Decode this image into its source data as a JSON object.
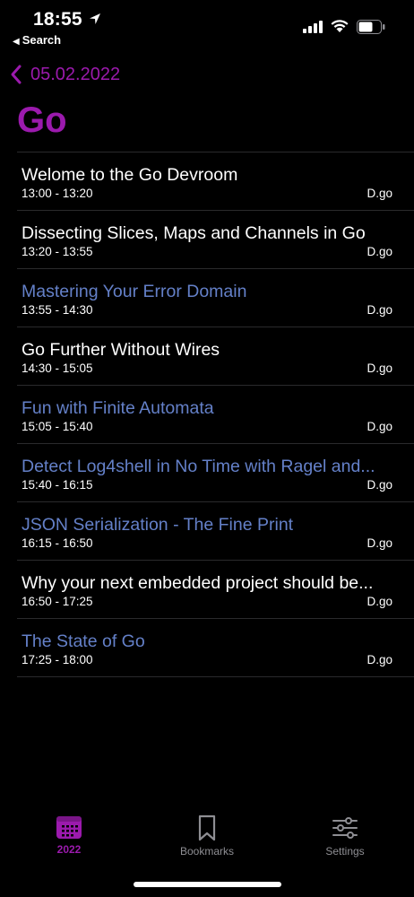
{
  "status_bar": {
    "time": "18:55",
    "back_app_label": "Search"
  },
  "nav": {
    "back_label": "05.02.2022",
    "title": "Go"
  },
  "colors": {
    "accent": "#9b1aad",
    "link_blue": "#6480c8",
    "separator": "#2a2a2c"
  },
  "talks": [
    {
      "title": "Welome to the Go Devroom",
      "time": "13:00 - 13:20",
      "room": "D.go",
      "style": "bright"
    },
    {
      "title": "Dissecting Slices, Maps and Channels in Go",
      "time": "13:20 - 13:55",
      "room": "D.go",
      "style": "bright"
    },
    {
      "title": "Mastering Your Error Domain",
      "time": "13:55 - 14:30",
      "room": "D.go",
      "style": "dim"
    },
    {
      "title": "Go Further Without Wires",
      "time": "14:30 - 15:05",
      "room": "D.go",
      "style": "bright"
    },
    {
      "title": "Fun with Finite Automata",
      "time": "15:05 - 15:40",
      "room": "D.go",
      "style": "dim"
    },
    {
      "title": "Detect Log4shell in No Time with Ragel and...",
      "time": "15:40 - 16:15",
      "room": "D.go",
      "style": "dim"
    },
    {
      "title": "JSON Serialization - The Fine Print",
      "time": "16:15 - 16:50",
      "room": "D.go",
      "style": "dim"
    },
    {
      "title": "Why your next embedded project should be...",
      "time": "16:50 - 17:25",
      "room": "D.go",
      "style": "bright"
    },
    {
      "title": "The State of Go",
      "time": "17:25 - 18:00",
      "room": "D.go",
      "style": "dim"
    }
  ],
  "tab_bar": {
    "tabs": [
      {
        "label": "2022",
        "icon": "calendar-icon",
        "selected": true
      },
      {
        "label": "Bookmarks",
        "icon": "bookmark-icon",
        "selected": false
      },
      {
        "label": "Settings",
        "icon": "sliders-icon",
        "selected": false
      }
    ]
  }
}
